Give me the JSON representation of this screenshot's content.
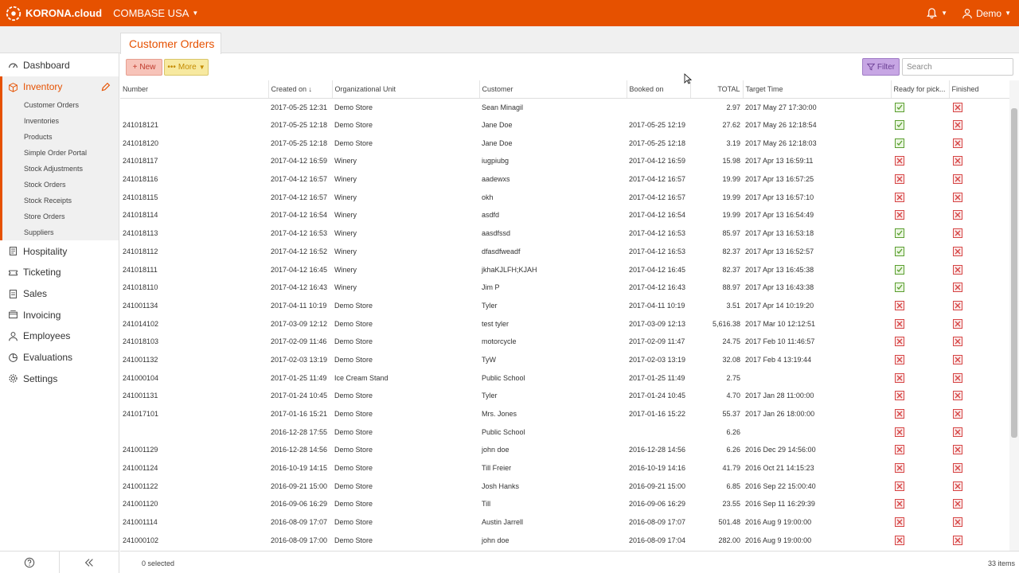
{
  "topbar": {
    "brand": "KORONA.cloud",
    "company": "COMBASE USA",
    "user": "Demo"
  },
  "tab": {
    "label": "Customer Orders"
  },
  "sidebar": {
    "dashboard": "Dashboard",
    "inventory": "Inventory",
    "subitems": [
      "Customer Orders",
      "Inventories",
      "Products",
      "Simple Order Portal",
      "Stock Adjustments",
      "Stock Orders",
      "Stock Receipts",
      "Store Orders",
      "Suppliers"
    ],
    "hospitality": "Hospitality",
    "ticketing": "Ticketing",
    "sales": "Sales",
    "invoicing": "Invoicing",
    "employees": "Employees",
    "evaluations": "Evaluations",
    "settings": "Settings"
  },
  "toolbar": {
    "new_label": "New",
    "more_label": "More",
    "filter_label": "Filter",
    "search_placeholder": "Search"
  },
  "table": {
    "columns": [
      "Number",
      "Created on",
      "Organizational Unit",
      "Customer",
      "Booked on",
      "TOTAL",
      "Target Time",
      "Ready for pick...",
      "Finished"
    ],
    "rows": [
      [
        "",
        "2017-05-25 12:31",
        "Demo Store",
        "Sean Minagil",
        "",
        "2.97",
        "2017 May 27 17:30:00",
        "ok",
        "no"
      ],
      [
        "241018121",
        "2017-05-25 12:18",
        "Demo Store",
        "Jane Doe",
        "2017-05-25 12:19",
        "27.62",
        "2017 May 26 12:18:54",
        "ok",
        "no"
      ],
      [
        "241018120",
        "2017-05-25 12:18",
        "Demo Store",
        "Jane Doe",
        "2017-05-25 12:18",
        "3.19",
        "2017 May 26 12:18:03",
        "ok",
        "no"
      ],
      [
        "241018117",
        "2017-04-12 16:59",
        "Winery",
        "iugpiubg",
        "2017-04-12 16:59",
        "15.98",
        "2017 Apr 13 16:59:11",
        "no",
        "no"
      ],
      [
        "241018116",
        "2017-04-12 16:57",
        "Winery",
        "aadewxs",
        "2017-04-12 16:57",
        "19.99",
        "2017 Apr 13 16:57:25",
        "no",
        "no"
      ],
      [
        "241018115",
        "2017-04-12 16:57",
        "Winery",
        "okh",
        "2017-04-12 16:57",
        "19.99",
        "2017 Apr 13 16:57:10",
        "no",
        "no"
      ],
      [
        "241018114",
        "2017-04-12 16:54",
        "Winery",
        "asdfd",
        "2017-04-12 16:54",
        "19.99",
        "2017 Apr 13 16:54:49",
        "no",
        "no"
      ],
      [
        "241018113",
        "2017-04-12 16:53",
        "Winery",
        "aasdfssd",
        "2017-04-12 16:53",
        "85.97",
        "2017 Apr 13 16:53:18",
        "ok",
        "no"
      ],
      [
        "241018112",
        "2017-04-12 16:52",
        "Winery",
        "dfasdfweadf",
        "2017-04-12 16:53",
        "82.37",
        "2017 Apr 13 16:52:57",
        "ok",
        "no"
      ],
      [
        "241018111",
        "2017-04-12 16:45",
        "Winery",
        "jkhaKJLFH;KJAH",
        "2017-04-12 16:45",
        "82.37",
        "2017 Apr 13 16:45:38",
        "ok",
        "no"
      ],
      [
        "241018110",
        "2017-04-12 16:43",
        "Winery",
        "Jim P",
        "2017-04-12 16:43",
        "88.97",
        "2017 Apr 13 16:43:38",
        "ok",
        "no"
      ],
      [
        "241001134",
        "2017-04-11 10:19",
        "Demo Store",
        "Tyler",
        "2017-04-11 10:19",
        "3.51",
        "2017 Apr 14 10:19:20",
        "no",
        "no"
      ],
      [
        "241014102",
        "2017-03-09 12:12",
        "Demo Store",
        "test tyler",
        "2017-03-09 12:13",
        "5,616.38",
        "2017 Mar 10 12:12:51",
        "no",
        "no"
      ],
      [
        "241018103",
        "2017-02-09 11:46",
        "Demo Store",
        "motorcycle",
        "2017-02-09 11:47",
        "24.75",
        "2017 Feb 10 11:46:57",
        "no",
        "no"
      ],
      [
        "241001132",
        "2017-02-03 13:19",
        "Demo Store",
        "TyW",
        "2017-02-03 13:19",
        "32.08",
        "2017 Feb 4 13:19:44",
        "no",
        "no"
      ],
      [
        "241000104",
        "2017-01-25 11:49",
        "Ice Cream Stand",
        "Public School",
        "2017-01-25 11:49",
        "2.75",
        "",
        "no",
        "no"
      ],
      [
        "241001131",
        "2017-01-24 10:45",
        "Demo Store",
        "Tyler",
        "2017-01-24 10:45",
        "4.70",
        "2017 Jan 28 11:00:00",
        "no",
        "no"
      ],
      [
        "241017101",
        "2017-01-16 15:21",
        "Demo Store",
        "Mrs. Jones",
        "2017-01-16 15:22",
        "55.37",
        "2017 Jan 26 18:00:00",
        "no",
        "no"
      ],
      [
        "",
        "2016-12-28 17:55",
        "Demo Store",
        "Public School",
        "",
        "6.26",
        "",
        "no",
        "no"
      ],
      [
        "241001129",
        "2016-12-28 14:56",
        "Demo Store",
        "john doe",
        "2016-12-28 14:56",
        "6.26",
        "2016 Dec 29 14:56:00",
        "no",
        "no"
      ],
      [
        "241001124",
        "2016-10-19 14:15",
        "Demo Store",
        "Till Freier",
        "2016-10-19 14:16",
        "41.79",
        "2016 Oct 21 14:15:23",
        "no",
        "no"
      ],
      [
        "241001122",
        "2016-09-21 15:00",
        "Demo Store",
        "Josh Hanks",
        "2016-09-21 15:00",
        "6.85",
        "2016 Sep 22 15:00:40",
        "no",
        "no"
      ],
      [
        "241001120",
        "2016-09-06 16:29",
        "Demo Store",
        "Till",
        "2016-09-06 16:29",
        "23.55",
        "2016 Sep 11 16:29:39",
        "no",
        "no"
      ],
      [
        "241001114",
        "2016-08-09 17:07",
        "Demo Store",
        "Austin Jarrell",
        "2016-08-09 17:07",
        "501.48",
        "2016 Aug 9 19:00:00",
        "no",
        "no"
      ],
      [
        "241000102",
        "2016-08-09 17:00",
        "Demo Store",
        "john doe",
        "2016-08-09 17:04",
        "282.00",
        "2016 Aug 9 19:00:00",
        "no",
        "no"
      ]
    ]
  },
  "footer": {
    "selected": "0 selected",
    "count": "33 items"
  },
  "colors": {
    "brand": "#e65100"
  }
}
